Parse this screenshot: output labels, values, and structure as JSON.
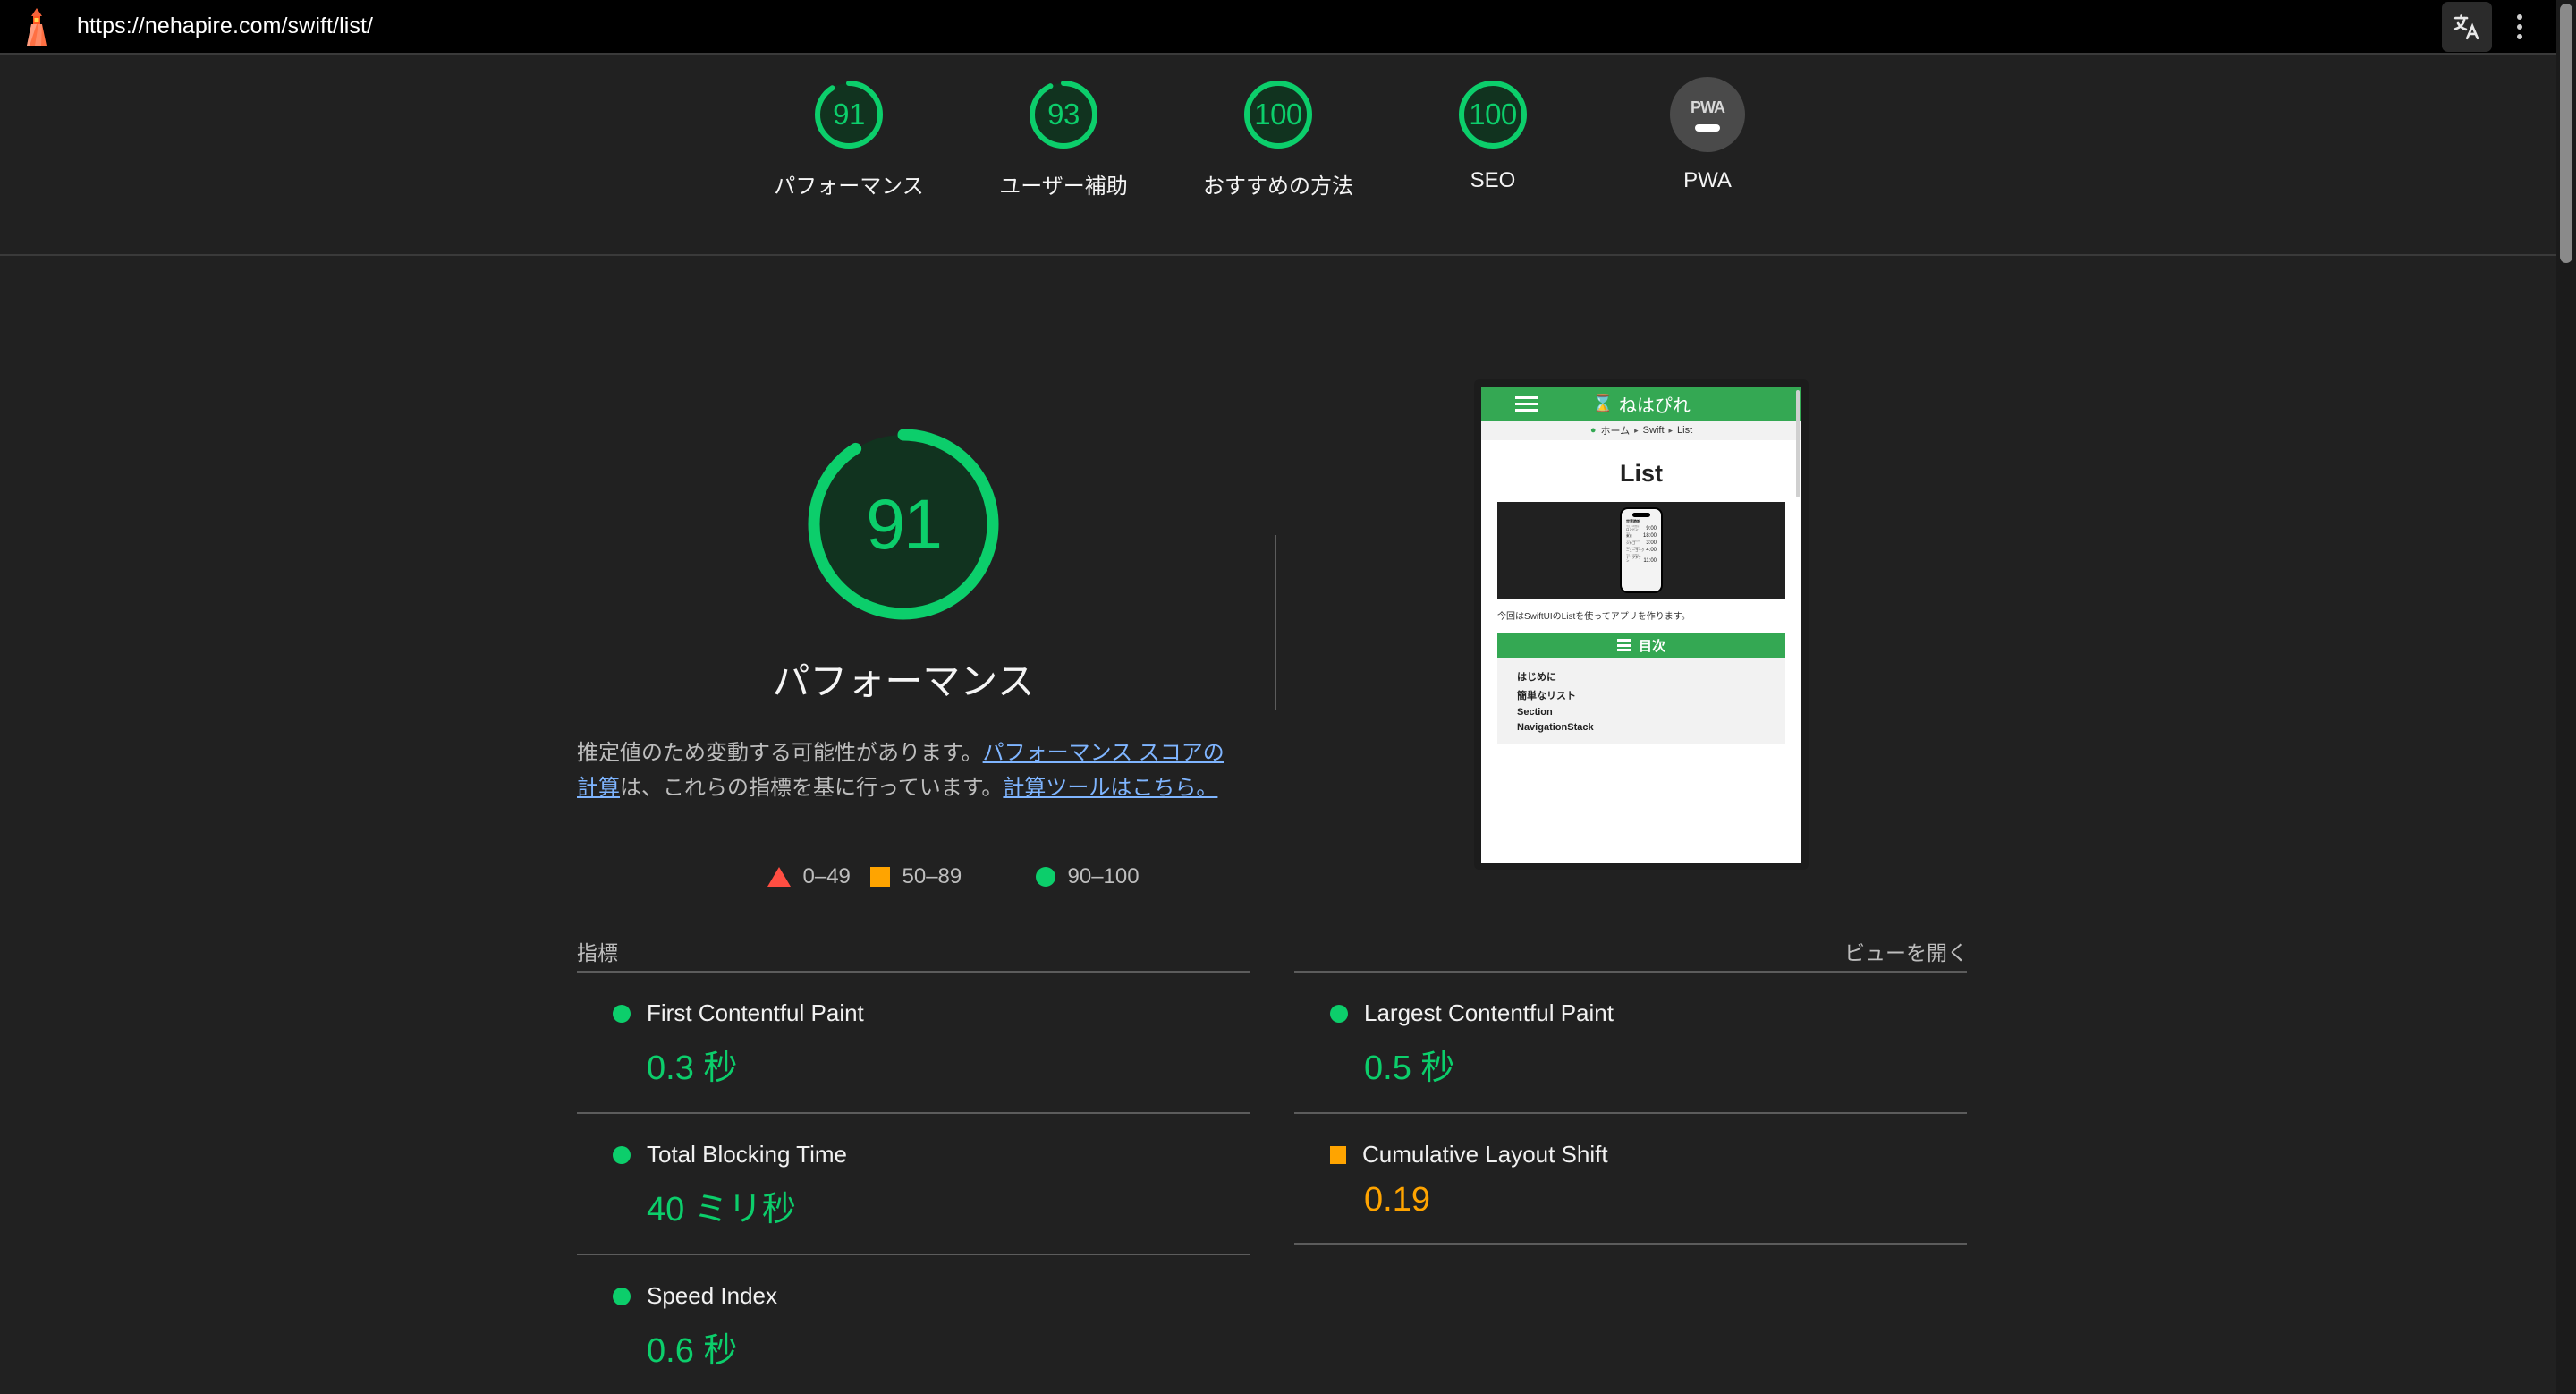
{
  "browser": {
    "url": "https://nehapire.com/swift/list/",
    "lighthouse_icon": "lighthouse-icon",
    "translate_icon": "translate-icon",
    "menu_icon": "kebab-menu-icon"
  },
  "scores": [
    {
      "value": "91",
      "label": "パフォーマンス",
      "pct": 91,
      "color": "#0cce6b"
    },
    {
      "value": "93",
      "label": "ユーザー補助",
      "pct": 93,
      "color": "#0cce6b"
    },
    {
      "value": "100",
      "label": "おすすめの方法",
      "pct": 100,
      "color": "#0cce6b"
    },
    {
      "value": "100",
      "label": "SEO",
      "pct": 100,
      "color": "#0cce6b"
    },
    {
      "value": "PWA",
      "label": "PWA",
      "pct": 0,
      "color": "#4a4a4a"
    }
  ],
  "category": {
    "score": "91",
    "title": "パフォーマンス",
    "desc_part1": "推定値のため変動する可能性があります。",
    "desc_link1": "パフォーマンス スコアの計算",
    "desc_part2": "は、これらの指標を基に行っています。",
    "desc_link2": "計算ツールはこちら。"
  },
  "legend": [
    {
      "icon": "triangle",
      "range": "0–49",
      "color": "#ff4e42"
    },
    {
      "icon": "square",
      "range": "50–89",
      "color": "#ffa400"
    },
    {
      "icon": "circle",
      "range": "90–100",
      "color": "#0cce6b"
    }
  ],
  "metrics_header": {
    "title": "指標",
    "open_view_link": "ビューを開く"
  },
  "metrics": {
    "left": [
      {
        "name": "First Contentful Paint",
        "value": "0.3 秒",
        "status": "circle",
        "color": "green"
      },
      {
        "name": "Total Blocking Time",
        "value": "40 ミリ秒",
        "status": "circle",
        "color": "green"
      },
      {
        "name": "Speed Index",
        "value": "0.6 秒",
        "status": "circle",
        "color": "green"
      }
    ],
    "right": [
      {
        "name": "Largest Contentful Paint",
        "value": "0.5 秒",
        "status": "circle",
        "color": "green"
      },
      {
        "name": "Cumulative Layout Shift",
        "value": "0.19",
        "status": "square",
        "color": "orange"
      }
    ]
  },
  "preview": {
    "brand": "ねはぴれ",
    "hourglass_icon": "hourglass-icon",
    "menu_icon": "hamburger-icon",
    "breadcrumb": {
      "home": "ホーム",
      "sep1": "▸",
      "level2": "Swift",
      "sep2": "▸",
      "level3": "List"
    },
    "page_title": "List",
    "caption": "今回はSwiftUIのListを使ってアプリを作ります。",
    "toc_title": "目次",
    "toc_items": [
      "はじめに",
      "簡単なリスト",
      "Section",
      "NavigationStack"
    ],
    "phone_app_title": "世界時計",
    "phone_rows": [
      {
        "sub": "今日、9時間前",
        "city": "ロンドン",
        "time": "9:00"
      },
      {
        "sub": "今日",
        "city": "東京",
        "time": "18:00"
      },
      {
        "sub": "今日、15時間前",
        "city": "シカゴ",
        "time": "3:00"
      },
      {
        "sub": "今日、14時間前",
        "city": "ニューヨーク",
        "time": "4:00"
      },
      {
        "sub": "今日、7時間前",
        "city": "ケープタウン",
        "time": "11:00"
      }
    ]
  }
}
